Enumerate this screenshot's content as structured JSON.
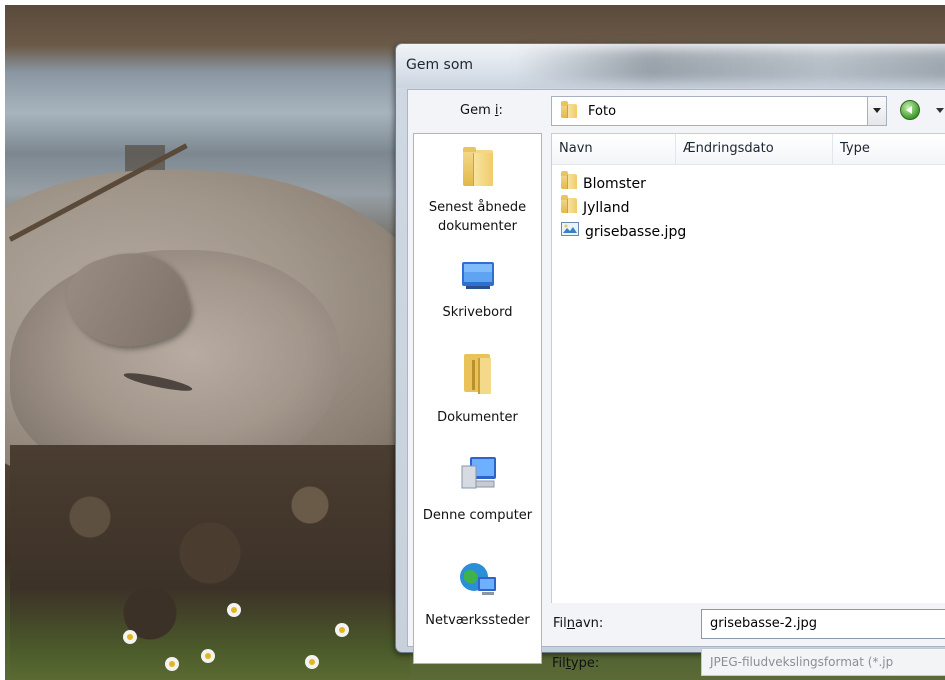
{
  "dialog": {
    "title": "Gem som",
    "save_in": {
      "label_pre": "Gem ",
      "label_key": "i",
      "label_post": ":",
      "current_folder": "Foto"
    },
    "places": [
      {
        "label": "Senest åbnede dokumenter",
        "icon": "recent-folder-icon"
      },
      {
        "label": "Skrivebord",
        "icon": "desktop-icon"
      },
      {
        "label": "Dokumenter",
        "icon": "documents-folder-icon"
      },
      {
        "label": "Denne computer",
        "icon": "computer-icon"
      },
      {
        "label": "Netværkssteder",
        "icon": "network-globe-icon"
      }
    ],
    "columns": [
      "Navn",
      "Ændringsdato",
      "Type"
    ],
    "files": [
      {
        "name": "Blomster",
        "icon": "folder-icon"
      },
      {
        "name": "Jylland",
        "icon": "folder-icon"
      },
      {
        "name": "grisebasse.jpg",
        "icon": "image-file-icon"
      }
    ],
    "filename": {
      "label_pre": "Fil",
      "label_key": "n",
      "label_post": "avn:",
      "value": "grisebasse-2.jpg"
    },
    "filetype": {
      "label_pre": "Fil",
      "label_key": "t",
      "label_post": "ype:",
      "value": "JPEG-filudvekslingsformat (*.jp"
    }
  }
}
